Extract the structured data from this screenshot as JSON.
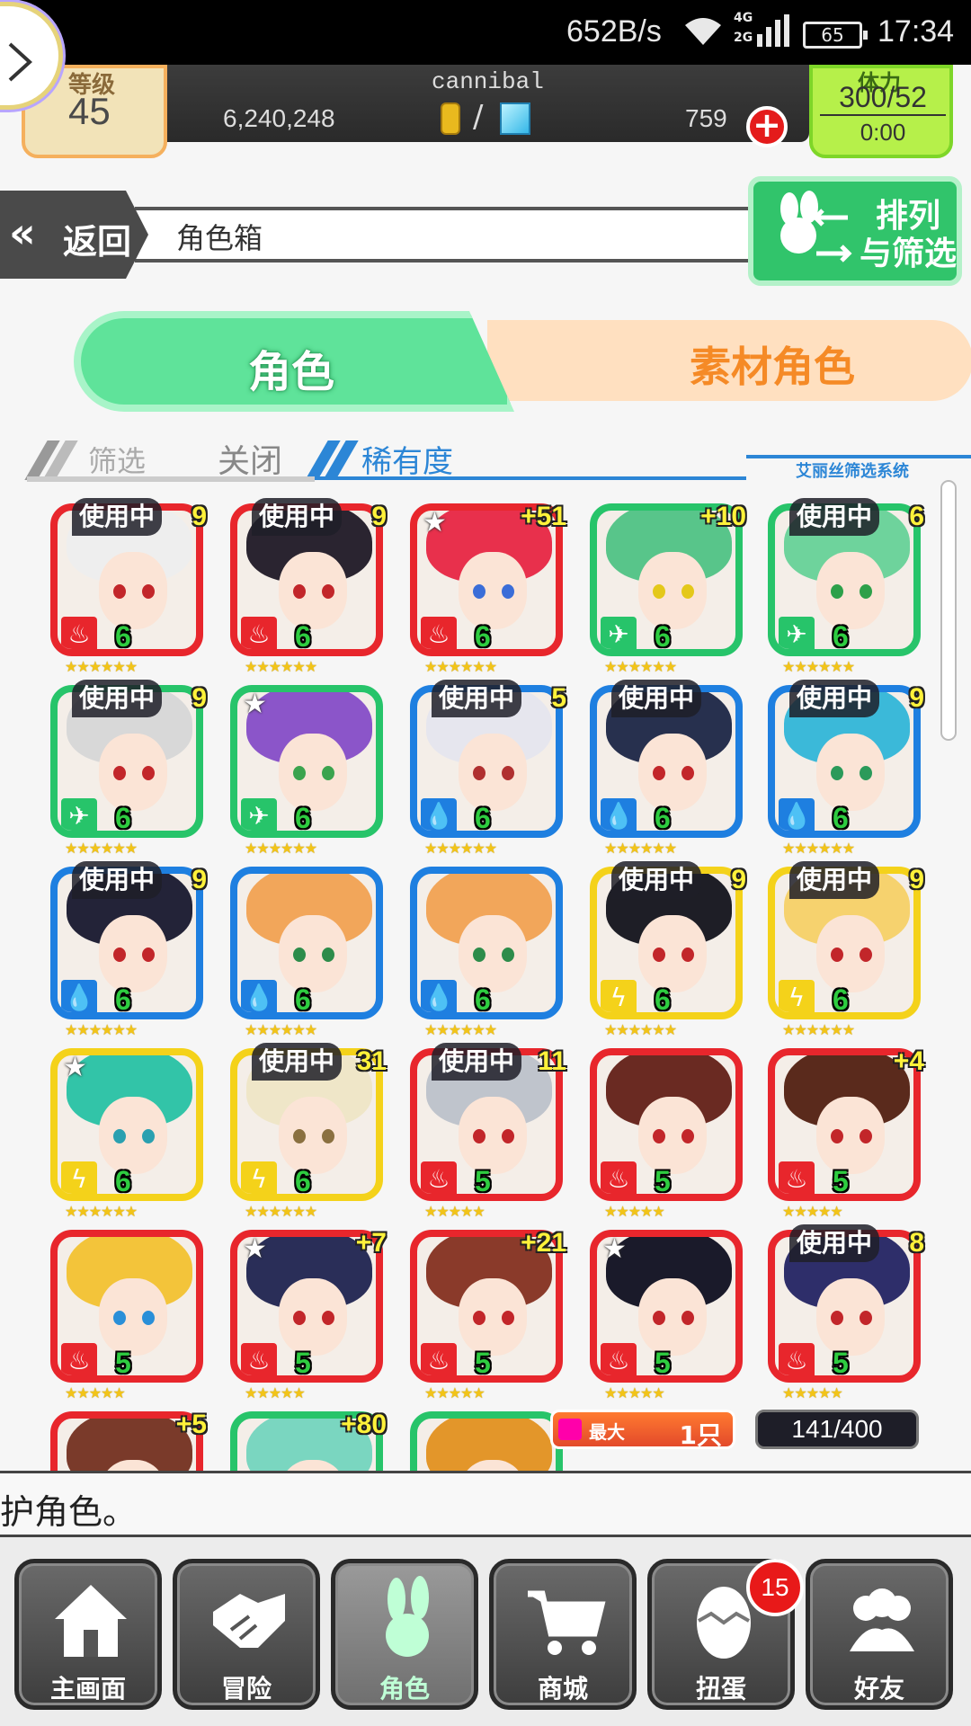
{
  "status_bar": {
    "net_speed": "652B/s",
    "network": [
      "4G",
      "2G"
    ],
    "battery": "65",
    "time": "17:34"
  },
  "header": {
    "level_label": "等级",
    "level": "45",
    "player_name": "cannibal",
    "coins": "6,240,248",
    "gems": "759",
    "stamina_label": "体力",
    "stamina": "300/52",
    "stamina_timer": "0:00"
  },
  "title_bar": {
    "back_label": "返回",
    "title": "角色箱",
    "sort_label_line1": "排列",
    "sort_label_line2": "与筛选"
  },
  "tabs": [
    {
      "label": "角色",
      "active": true
    },
    {
      "label": "素材角色",
      "active": false
    }
  ],
  "filter": {
    "label": "筛选",
    "toggle": "关闭",
    "mode": "稀有度",
    "system_name": "艾丽丝筛选系统"
  },
  "cards": [
    {
      "elem": "fire",
      "rarity": "6",
      "stars": 6,
      "badge": "使用中",
      "plus": "9",
      "hair": "#eeeeee",
      "eye": "#c2262a"
    },
    {
      "elem": "fire",
      "rarity": "6",
      "stars": 6,
      "badge": "使用中",
      "plus": "9",
      "hair": "#2a2430",
      "eye": "#c2262a"
    },
    {
      "elem": "fire",
      "rarity": "6",
      "stars": 6,
      "badge": "star",
      "plus": "+51",
      "hair": "#e8304c",
      "eye": "#3a6dd8"
    },
    {
      "elem": "wind",
      "rarity": "6",
      "stars": 6,
      "badge": "",
      "plus": "+10",
      "hair": "#58c58a",
      "eye": "#e4c81a"
    },
    {
      "elem": "wind",
      "rarity": "6",
      "stars": 6,
      "badge": "使用中",
      "plus": "6",
      "hair": "#6ed39c",
      "eye": "#2da04a"
    },
    {
      "elem": "wind",
      "rarity": "6",
      "stars": 6,
      "badge": "使用中",
      "plus": "9",
      "hair": "#d8d8d8",
      "eye": "#c2262a"
    },
    {
      "elem": "wind",
      "rarity": "6",
      "stars": 6,
      "badge": "star",
      "plus": "",
      "hair": "#8b55c9",
      "eye": "#3ba34e"
    },
    {
      "elem": "water",
      "rarity": "6",
      "stars": 6,
      "badge": "使用中",
      "plus": "5",
      "hair": "#e6e6ee",
      "eye": "#b03030"
    },
    {
      "elem": "water",
      "rarity": "6",
      "stars": 6,
      "badge": "使用中",
      "plus": "",
      "hair": "#27304e",
      "eye": "#c2262a"
    },
    {
      "elem": "water",
      "rarity": "6",
      "stars": 6,
      "badge": "使用中",
      "plus": "9",
      "hair": "#3bb9d9",
      "eye": "#2b9a5a"
    },
    {
      "elem": "water",
      "rarity": "6",
      "stars": 6,
      "badge": "使用中",
      "plus": "9",
      "hair": "#232338",
      "eye": "#c2262a"
    },
    {
      "elem": "water",
      "rarity": "6",
      "stars": 6,
      "badge": "",
      "plus": "",
      "hair": "#f2a65a",
      "eye": "#2d8c4a"
    },
    {
      "elem": "water",
      "rarity": "6",
      "stars": 6,
      "badge": "",
      "plus": "",
      "hair": "#f2a65a",
      "eye": "#2d8c4a"
    },
    {
      "elem": "thunder",
      "rarity": "6",
      "stars": 6,
      "badge": "使用中",
      "plus": "9",
      "hair": "#1e1e26",
      "eye": "#c2262a"
    },
    {
      "elem": "thunder",
      "rarity": "6",
      "stars": 6,
      "badge": "使用中",
      "plus": "9",
      "hair": "#f6d26e",
      "eye": "#c2262a"
    },
    {
      "elem": "thunder",
      "rarity": "6",
      "stars": 6,
      "badge": "star",
      "plus": "",
      "hair": "#32c4a8",
      "eye": "#2aa0b0"
    },
    {
      "elem": "thunder",
      "rarity": "6",
      "stars": 6,
      "badge": "使用中",
      "plus": "31",
      "hair": "#efe6c8",
      "eye": "#8a7040"
    },
    {
      "elem": "fire",
      "rarity": "5",
      "stars": 5,
      "badge": "使用中",
      "plus": "11",
      "hair": "#bfc4cc",
      "eye": "#c2262a"
    },
    {
      "elem": "fire",
      "rarity": "5",
      "stars": 5,
      "badge": "",
      "plus": "",
      "hair": "#6a2a22",
      "eye": "#c2262a"
    },
    {
      "elem": "fire",
      "rarity": "5",
      "stars": 5,
      "badge": "",
      "plus": "+4",
      "hair": "#5a2a1c",
      "eye": "#c2262a"
    },
    {
      "elem": "fire",
      "rarity": "5",
      "stars": 5,
      "badge": "",
      "plus": "",
      "hair": "#f3c43a",
      "eye": "#2a8fd8"
    },
    {
      "elem": "fire",
      "rarity": "5",
      "stars": 5,
      "badge": "star",
      "plus": "+7",
      "hair": "#2a2e58",
      "eye": "#c2262a"
    },
    {
      "elem": "fire",
      "rarity": "5",
      "stars": 5,
      "badge": "",
      "plus": "+21",
      "hair": "#8a3a2a",
      "eye": "#c2262a"
    },
    {
      "elem": "fire",
      "rarity": "5",
      "stars": 5,
      "badge": "star",
      "plus": "",
      "hair": "#1a1a2a",
      "eye": "#c2262a"
    },
    {
      "elem": "fire",
      "rarity": "5",
      "stars": 5,
      "badge": "使用中",
      "plus": "8",
      "hair": "#2e2e6a",
      "eye": "#c2262a"
    },
    {
      "elem": "fire",
      "rarity": "",
      "stars": 0,
      "badge": "",
      "plus": "+5",
      "hair": "#7a3a2a",
      "eye": "#c2262a"
    },
    {
      "elem": "wind",
      "rarity": "",
      "stars": 0,
      "badge": "",
      "plus": "+80",
      "hair": "#7ad6c0",
      "eye": "#2aa06a"
    },
    {
      "elem": "wind",
      "rarity": "",
      "stars": 0,
      "badge": "",
      "plus": "",
      "hair": "#e3962a",
      "eye": "#2a6ad8"
    }
  ],
  "elements": {
    "fire": {
      "color": "#e8262c",
      "glyph": "♨"
    },
    "wind": {
      "color": "#27c46a",
      "glyph": "✈"
    },
    "water": {
      "color": "#1e7fe0",
      "glyph": "💧"
    },
    "thunder": {
      "color": "#f4d21a",
      "glyph": "ϟ"
    }
  },
  "counters": {
    "max_label": "最大",
    "max_value": "1只",
    "box_count": "141/400"
  },
  "message": "护角色。",
  "nav": [
    {
      "label": "主画面",
      "icon": "home-icon"
    },
    {
      "label": "冒险",
      "icon": "handshake-icon"
    },
    {
      "label": "角色",
      "icon": "rabbit-icon",
      "active": true
    },
    {
      "label": "商城",
      "icon": "cart-icon"
    },
    {
      "label": "扭蛋",
      "icon": "egg-icon"
    },
    {
      "label": "好友",
      "icon": "friends-icon"
    }
  ],
  "gacha_badge": "15"
}
